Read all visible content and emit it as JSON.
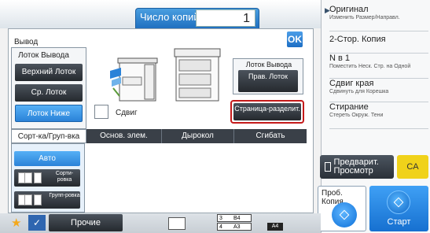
{
  "header": {
    "copies_label": "Число копий",
    "copies_value": "1"
  },
  "panel": {
    "output_label": "Вывод",
    "ok_label": "OK",
    "tray_group_title": "Лоток Вывода",
    "trays": [
      "Верхний Лоток",
      "Ср. Лоток",
      "Лоток Ниже"
    ],
    "right_tray_title": "Лоток Вывода",
    "right_tray_btn": "Прав. Лоток",
    "separator_btn": "Страница-разделит.",
    "shift_label": "Сдвиг"
  },
  "tabs": [
    "Сорт-ка/Груп-вка",
    "Основ. элем.",
    "Дырокол",
    "Сгибать"
  ],
  "sort": {
    "auto": "Авто",
    "sort": "Сорти-ровка",
    "group": "Групп-ровка"
  },
  "right_menu": [
    {
      "title": "Оригинал",
      "sub": "Изменить Размер/Направл."
    },
    {
      "title": "2-Стор. Копия",
      "sub": ""
    },
    {
      "title": "N в 1",
      "sub": "Поместить Неск. Стр. на Одной"
    },
    {
      "title": "Сдвиг края",
      "sub": "Сдвинуть для Корешка"
    },
    {
      "title": "Стирание",
      "sub": "Стереть Окруж. Тени"
    }
  ],
  "buttons": {
    "preview": "Предварит. Просмотр",
    "ca": "CA",
    "trial": "Проб. Копия",
    "start": "Старт",
    "other": "Прочие"
  },
  "paper_tray": [
    {
      "num": "3",
      "size": "B4"
    },
    {
      "num": "4",
      "size": "A3"
    }
  ],
  "paper_badge": "A4",
  "colors": {
    "accent_blue": "#2a82d8",
    "highlight_red": "#c41a1a",
    "ca_yellow": "#f0d21a",
    "star": "#f4a81c"
  }
}
